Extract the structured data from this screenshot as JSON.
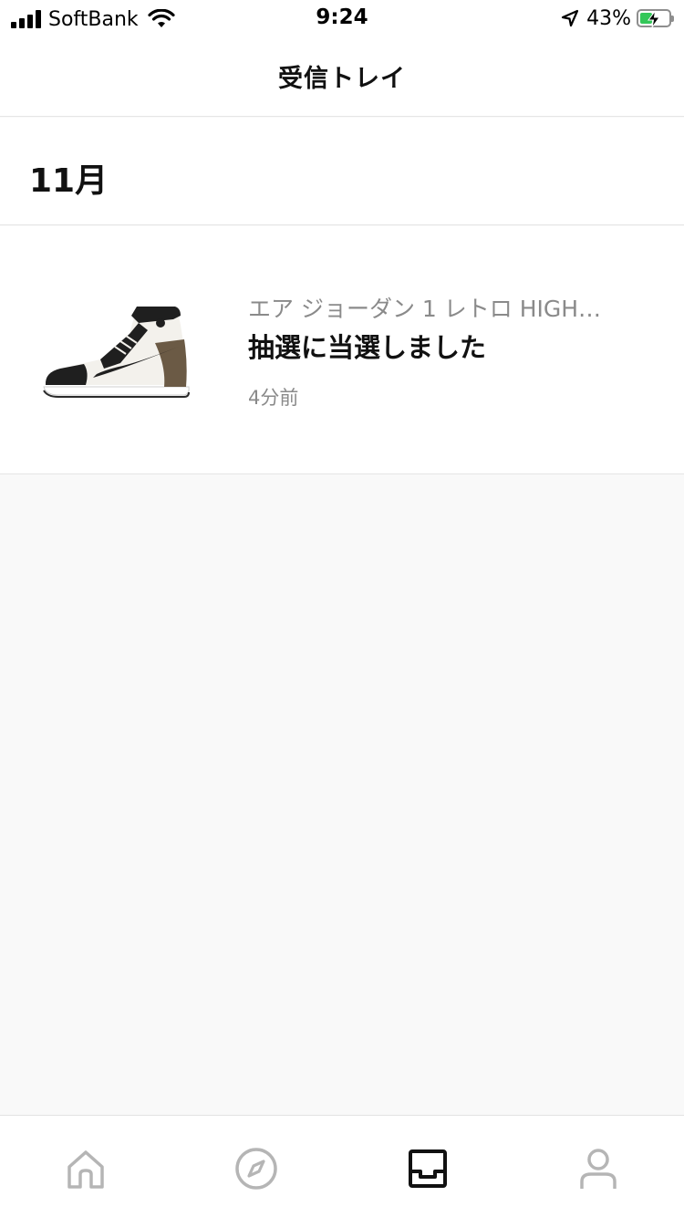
{
  "status_bar": {
    "carrier": "SoftBank",
    "time": "9:24",
    "battery": "43%",
    "battery_level": 0.43,
    "icons": [
      "signal-icon",
      "wifi-icon",
      "location-arrow-icon",
      "battery-charging-icon"
    ]
  },
  "nav": {
    "title": "受信トレイ"
  },
  "inbox": {
    "section_label": "11月",
    "items": [
      {
        "product": "エア ジョーダン 1 レトロ HIGH…",
        "message": "抽選に当選しました",
        "time": "4分前",
        "image_icon": "sneaker-image"
      }
    ]
  },
  "tab_bar": {
    "items": [
      {
        "name": "home",
        "icon": "home-icon",
        "active": false
      },
      {
        "name": "discover",
        "icon": "compass-icon",
        "active": false
      },
      {
        "name": "inbox",
        "icon": "inbox-tray-icon",
        "active": true
      },
      {
        "name": "profile",
        "icon": "person-icon",
        "active": false
      }
    ]
  },
  "colors": {
    "accent_active": "#111111",
    "inactive_icon": "#b5b5b5",
    "secondary_text": "#8a8a8a",
    "battery_green": "#34c759"
  }
}
